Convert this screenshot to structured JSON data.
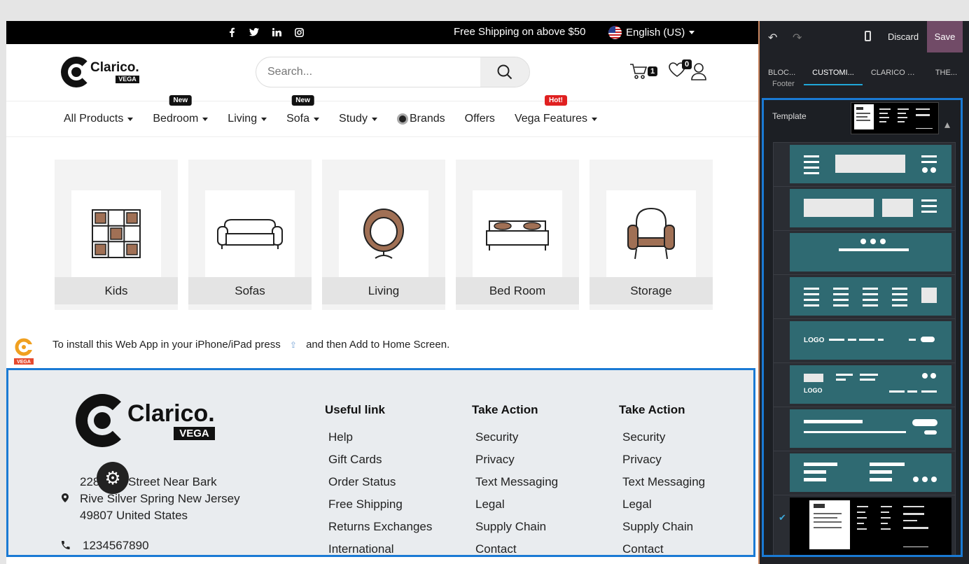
{
  "topbar": {
    "shipping_text": "Free Shipping on above $50",
    "language": "English (US)",
    "social_icons": [
      "facebook-icon",
      "twitter-icon",
      "linkedin-icon",
      "instagram-icon"
    ]
  },
  "header": {
    "search_placeholder": "Search...",
    "cart_count": "1",
    "wishlist_count": "0"
  },
  "nav": {
    "items": [
      {
        "label": "All Products",
        "dropdown": true,
        "tag": ""
      },
      {
        "label": "Bedroom",
        "dropdown": true,
        "tag": "New"
      },
      {
        "label": "Living",
        "dropdown": true,
        "tag": ""
      },
      {
        "label": "Sofa",
        "dropdown": true,
        "tag": "New"
      },
      {
        "label": "Study",
        "dropdown": true,
        "tag": ""
      },
      {
        "label": "Brands",
        "dropdown": false,
        "tag": ""
      },
      {
        "label": "Offers",
        "dropdown": false,
        "tag": ""
      },
      {
        "label": "Vega Features",
        "dropdown": true,
        "tag": "Hot!"
      }
    ]
  },
  "categories": [
    "Kids",
    "Sofas",
    "Living",
    "Bed Room",
    "Storage"
  ],
  "install": {
    "text_before": "To install this Web App in your iPhone/iPad press",
    "text_after": "and then Add to Home Screen."
  },
  "footer": {
    "address": [
      "228 Oak Street Near Bark",
      "Rive Silver Spring New Jersey",
      "49807 United States"
    ],
    "phone": "1234567890",
    "columns": [
      {
        "title": "Useful link",
        "links": [
          "Help",
          "Gift Cards",
          "Order Status",
          "Free Shipping",
          "Returns Exchanges",
          "International"
        ]
      },
      {
        "title": "Take Action",
        "links": [
          "Security",
          "Privacy",
          "Text Messaging",
          "Legal",
          "Supply Chain",
          "Contact"
        ]
      },
      {
        "title": "Take Action",
        "links": [
          "Security",
          "Privacy",
          "Text Messaging",
          "Legal",
          "Supply Chain",
          "Contact"
        ]
      }
    ]
  },
  "brand": {
    "name": "Clarico.",
    "tm": "™",
    "sub": "VEGA"
  },
  "editor": {
    "discard": "Discard",
    "save": "Save",
    "tabs": [
      "BLOC...",
      "CUSTOMI...",
      "CLARICO VE...",
      "THE..."
    ],
    "section_label": "Footer",
    "template_label": "Template",
    "accent_color": "#714b67",
    "selection_color": "#1a7ad4"
  }
}
